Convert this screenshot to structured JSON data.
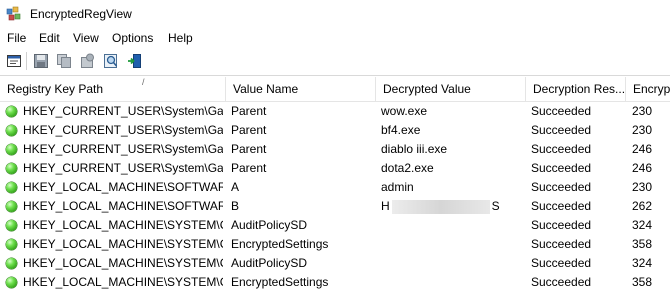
{
  "window": {
    "title": "EncryptedRegView"
  },
  "menu": [
    "File",
    "Edit",
    "View",
    "Options",
    "Help"
  ],
  "toolbar": {
    "icons": [
      "properties-icon",
      "save-icon",
      "copy-icon",
      "html-report-icon",
      "find-icon",
      "exit-icon"
    ]
  },
  "colors": {
    "status_ok": "#3cb521"
  },
  "columns": [
    "Registry Key Path",
    "Value Name",
    "Decrypted Value",
    "Decryption Res...",
    "Encrypte"
  ],
  "sort_indicator": "/",
  "rows": [
    {
      "path": "HKEY_CURRENT_USER\\System\\Gam...",
      "name": "Parent",
      "value": "wow.exe",
      "result": "Succeeded",
      "size": "230"
    },
    {
      "path": "HKEY_CURRENT_USER\\System\\Gam...",
      "name": "Parent",
      "value": "bf4.exe",
      "result": "Succeeded",
      "size": "230"
    },
    {
      "path": "HKEY_CURRENT_USER\\System\\Gam...",
      "name": "Parent",
      "value": "diablo iii.exe",
      "result": "Succeeded",
      "size": "246"
    },
    {
      "path": "HKEY_CURRENT_USER\\System\\Gam...",
      "name": "Parent",
      "value": "dota2.exe",
      "result": "Succeeded",
      "size": "246"
    },
    {
      "path": "HKEY_LOCAL_MACHINE\\SOFTWAR...",
      "name": "A",
      "value": "admin",
      "result": "Succeeded",
      "size": "230"
    },
    {
      "path": "HKEY_LOCAL_MACHINE\\SOFTWAR...",
      "name": "B",
      "value_prefix": "H",
      "value_suffix": "S",
      "redacted": true,
      "result": "Succeeded",
      "size": "262"
    },
    {
      "path": "HKEY_LOCAL_MACHINE\\SYSTEM\\C...",
      "name": "AuditPolicySD",
      "value": "",
      "result": "Succeeded",
      "size": "324"
    },
    {
      "path": "HKEY_LOCAL_MACHINE\\SYSTEM\\C...",
      "name": "EncryptedSettings",
      "value": "",
      "result": "Succeeded",
      "size": "358"
    },
    {
      "path": "HKEY_LOCAL_MACHINE\\SYSTEM\\C...",
      "name": "AuditPolicySD",
      "value": "",
      "result": "Succeeded",
      "size": "324"
    },
    {
      "path": "HKEY_LOCAL_MACHINE\\SYSTEM\\C...",
      "name": "EncryptedSettings",
      "value": "",
      "result": "Succeeded",
      "size": "358"
    }
  ]
}
